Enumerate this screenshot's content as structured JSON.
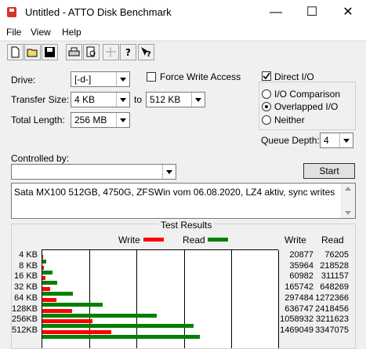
{
  "window": {
    "title": "Untitled - ATTO Disk Benchmark",
    "minimize": "—",
    "maximize": "☐",
    "close": "✕"
  },
  "menu": {
    "file": "File",
    "view": "View",
    "help": "Help"
  },
  "toolbar": [
    "new-icon",
    "open-icon",
    "save-icon",
    "print-icon",
    "print-preview-icon",
    "move-icon",
    "help-icon",
    "context-help-icon"
  ],
  "form": {
    "drive_label": "Drive:",
    "drive_value": "[-d-]",
    "transfer_label": "Transfer Size:",
    "transfer_from": "4 KB",
    "transfer_to_word": "to",
    "transfer_to": "512 KB",
    "length_label": "Total Length:",
    "length_value": "256 MB",
    "force_write": "Force Write Access",
    "direct_io": "Direct I/O",
    "io_comparison": "I/O Comparison",
    "overlapped_io": "Overlapped I/O",
    "neither": "Neither",
    "queue_label": "Queue Depth:",
    "queue_value": "4",
    "controlled_label": "Controlled by:",
    "controlled_value": "",
    "start_label": "Start",
    "description": "Sata MX100 512GB, 4750G, ZFSWin vom 06.08.2020, LZ4 aktiv, sync writes"
  },
  "results": {
    "title": "Test Results",
    "legend_write": "Write",
    "legend_read": "Read",
    "col_write": "Write",
    "col_read": "Read",
    "colors": {
      "write": "#ff0000",
      "read": "#008000"
    }
  },
  "chart_data": {
    "type": "bar",
    "categories": [
      "4 KB",
      "8 KB",
      "16 KB",
      "32 KB",
      "64 KB",
      "128KB",
      "256KB",
      "512KB"
    ],
    "series": [
      {
        "name": "Write",
        "values": [
          20877,
          35964,
          60982,
          165742,
          297484,
          636747,
          1058932,
          1469049
        ]
      },
      {
        "name": "Read",
        "values": [
          76205,
          218528,
          311157,
          648269,
          1272366,
          2418456,
          3211623,
          3347075
        ]
      }
    ],
    "xlim": [
      0,
      5000000
    ],
    "write_text": [
      "20877",
      "35964",
      "60982",
      "165742",
      "297484",
      "636747",
      "1058932",
      "1469049"
    ],
    "read_text": [
      "76205",
      "218528",
      "311157",
      "648269",
      "1272366",
      "2418456",
      "3211623",
      "3347075"
    ]
  }
}
